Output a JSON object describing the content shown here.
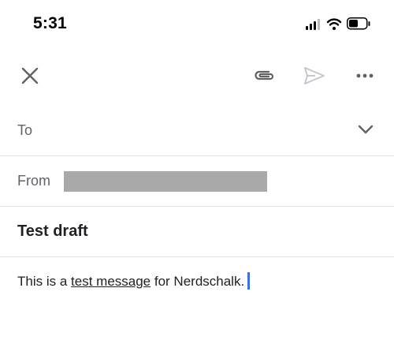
{
  "status_bar": {
    "time": "5:31"
  },
  "toolbar": {
    "close_icon": "close-icon",
    "attach_icon": "paperclip-icon",
    "send_icon": "send-icon",
    "more_icon": "more-horizontal-icon"
  },
  "compose": {
    "to_label": "To",
    "from_label": "From",
    "subject": "Test draft",
    "body_before": "This is a ",
    "body_link": "test message",
    "body_after": " for Nerdschalk."
  },
  "colors": {
    "caret": "#3b6fe8",
    "redaction": "#a9a9a9",
    "icon_gray": "#5f6368",
    "send_disabled": "#c4c7cc"
  }
}
